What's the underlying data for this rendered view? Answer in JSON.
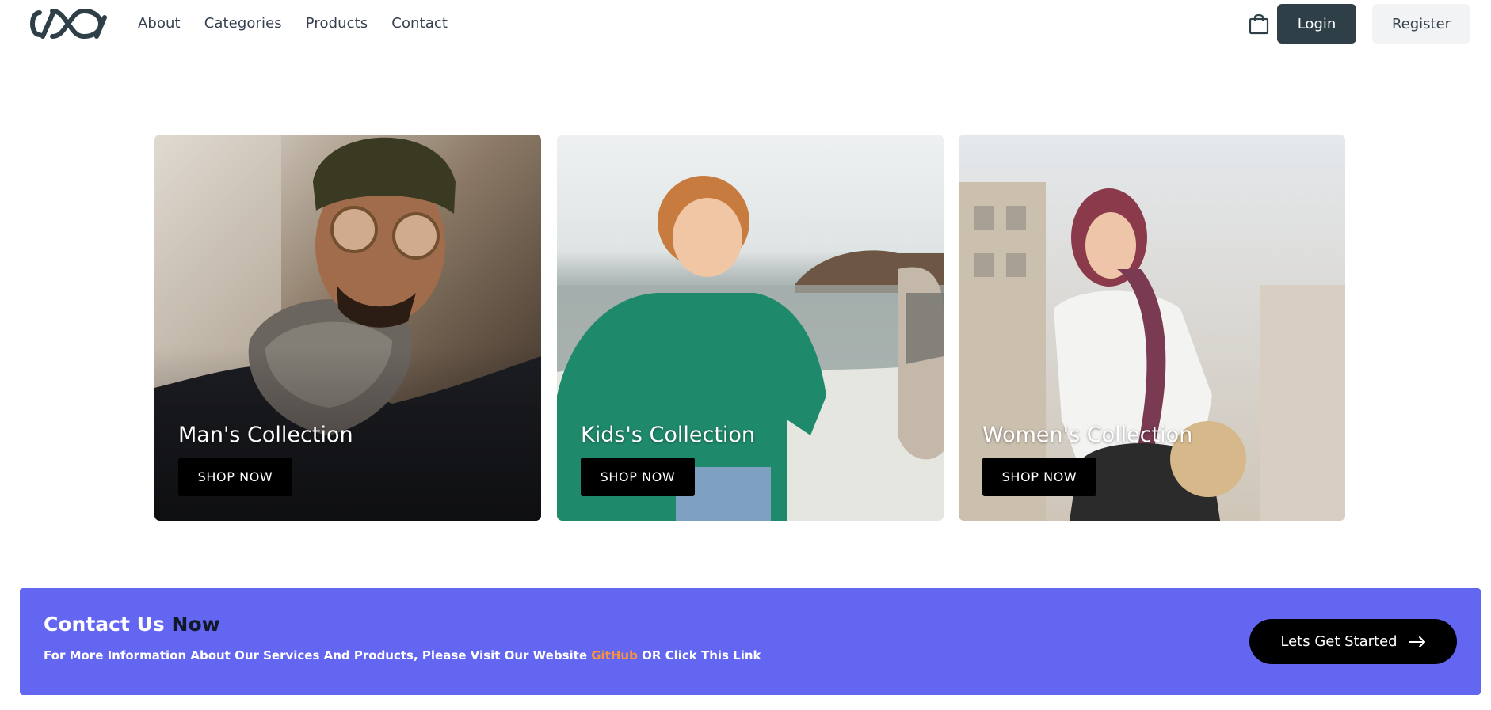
{
  "header": {
    "logo_icon": "chain-link-logo",
    "nav": [
      "About",
      "Categories",
      "Products",
      "Contact"
    ],
    "cart_icon": "shopping-bag-icon",
    "login_label": "Login",
    "register_label": "Register"
  },
  "collections": [
    {
      "title": "Man's Collection",
      "button": "SHOP NOW"
    },
    {
      "title": "Kids's Collection",
      "button": "SHOP NOW"
    },
    {
      "title": "Women's Collection",
      "button": "SHOP NOW"
    }
  ],
  "contact": {
    "title_main": "Contact Us",
    "title_accent": "Now",
    "subtitle_before": "For More Information About Our Services And Products, Please Visit Our Website",
    "subtitle_link": "GitHub",
    "subtitle_after": "OR Click This Link",
    "cta_label": "Lets Get Started",
    "cta_icon": "arrow-right-icon"
  },
  "colors": {
    "login_bg": "#2f3f47",
    "register_bg": "#f1f3f4",
    "banner_bg": "#6366f1",
    "link_accent": "#fb923c"
  }
}
